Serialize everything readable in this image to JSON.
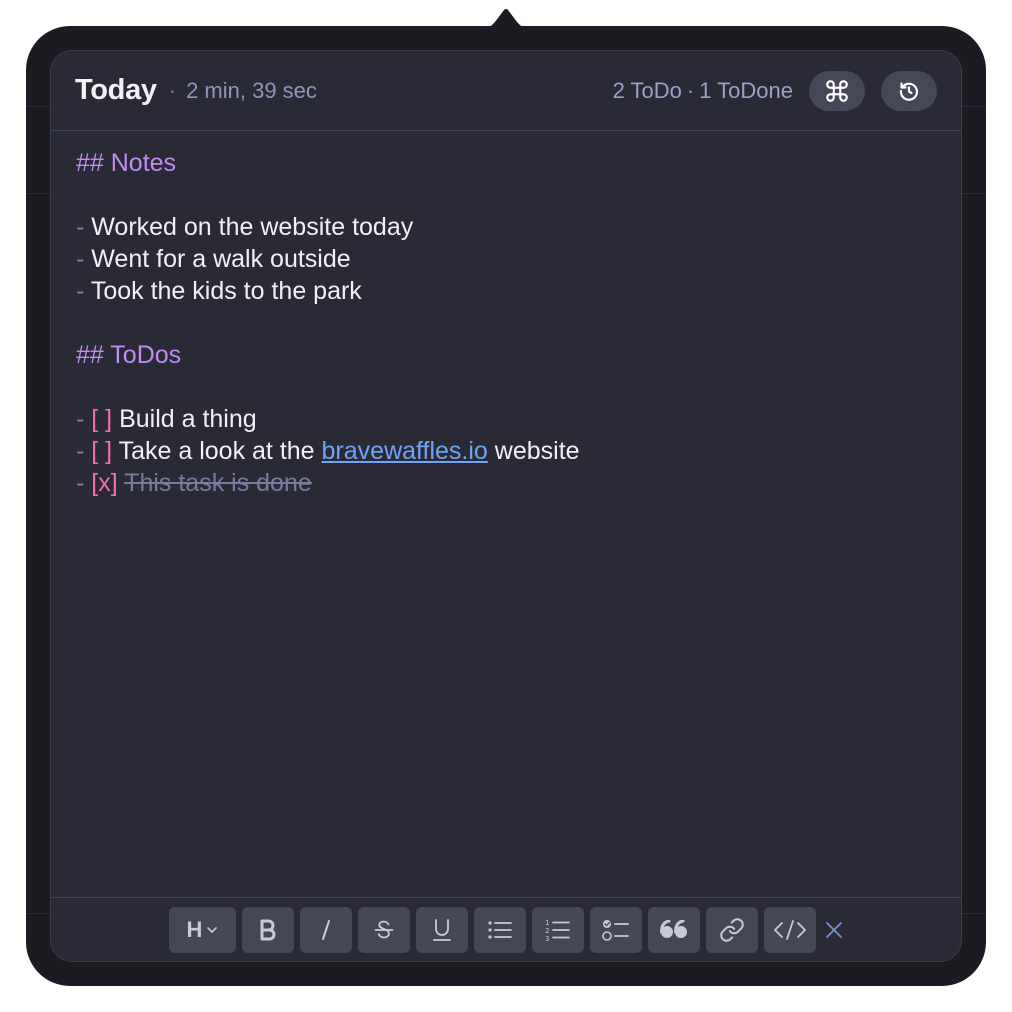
{
  "header": {
    "title": "Today",
    "separator": "·",
    "elapsed": "2 min, 39 sec",
    "todo_count": "2 ToDo",
    "count_separator": "·",
    "done_count": "1 ToDone",
    "shortcuts_icon": "command-icon",
    "reset_icon": "reset-icon"
  },
  "editor": {
    "notes_heading": "## Notes",
    "notes": [
      {
        "dash": "-",
        "text": " Worked on the website today"
      },
      {
        "dash": "-",
        "text": " Went for a walk outside"
      },
      {
        "dash": "-",
        "text": " Took the kids to the park"
      }
    ],
    "todos_heading": "## ToDos",
    "todos": [
      {
        "dash": "-",
        "box": "[ ]",
        "text": " Build a thing"
      },
      {
        "dash": "-",
        "box": "[ ]",
        "text_before": " Take a look at the ",
        "link": "bravewaffles.io",
        "text_after": " website"
      },
      {
        "dash": "-",
        "box": "[x]",
        "text": "This task is done"
      }
    ]
  },
  "toolbar": {
    "heading_label": "H",
    "buttons": [
      "heading-icon",
      "bold-icon",
      "italic-icon",
      "strikethrough-icon",
      "underline-icon",
      "bullet-list-icon",
      "numbered-list-icon",
      "checklist-icon",
      "quote-icon",
      "link-icon",
      "code-icon",
      "close-icon"
    ]
  },
  "colors": {
    "background": "#292a35",
    "heading": "#c08cf0",
    "checkbox": "#ef6ea9",
    "link": "#6ea4f7",
    "muted": "#8f95bd"
  }
}
